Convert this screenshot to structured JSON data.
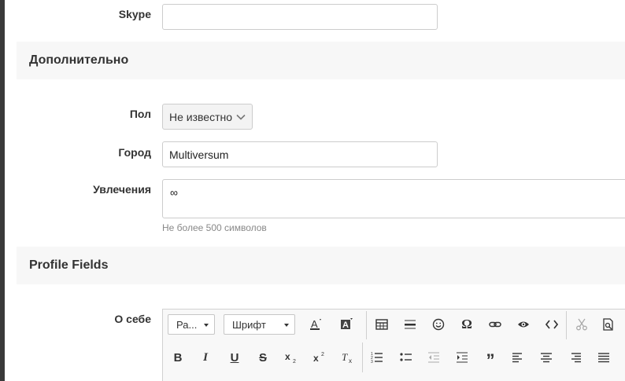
{
  "fields": {
    "skype": {
      "label": "Skype",
      "value": ""
    },
    "gender": {
      "label": "Пол",
      "value": "Не известно"
    },
    "city": {
      "label": "Город",
      "value": "Multiversum"
    },
    "hobbies": {
      "label": "Увлечения",
      "value": "∞",
      "hint": "Не более 500 символов"
    },
    "about": {
      "label": "О себе"
    }
  },
  "sections": {
    "additional": "Дополнительно",
    "profile_fields": "Profile Fields"
  },
  "editor": {
    "format_dropdown": "Ра...",
    "font_dropdown": "Шрифт"
  }
}
